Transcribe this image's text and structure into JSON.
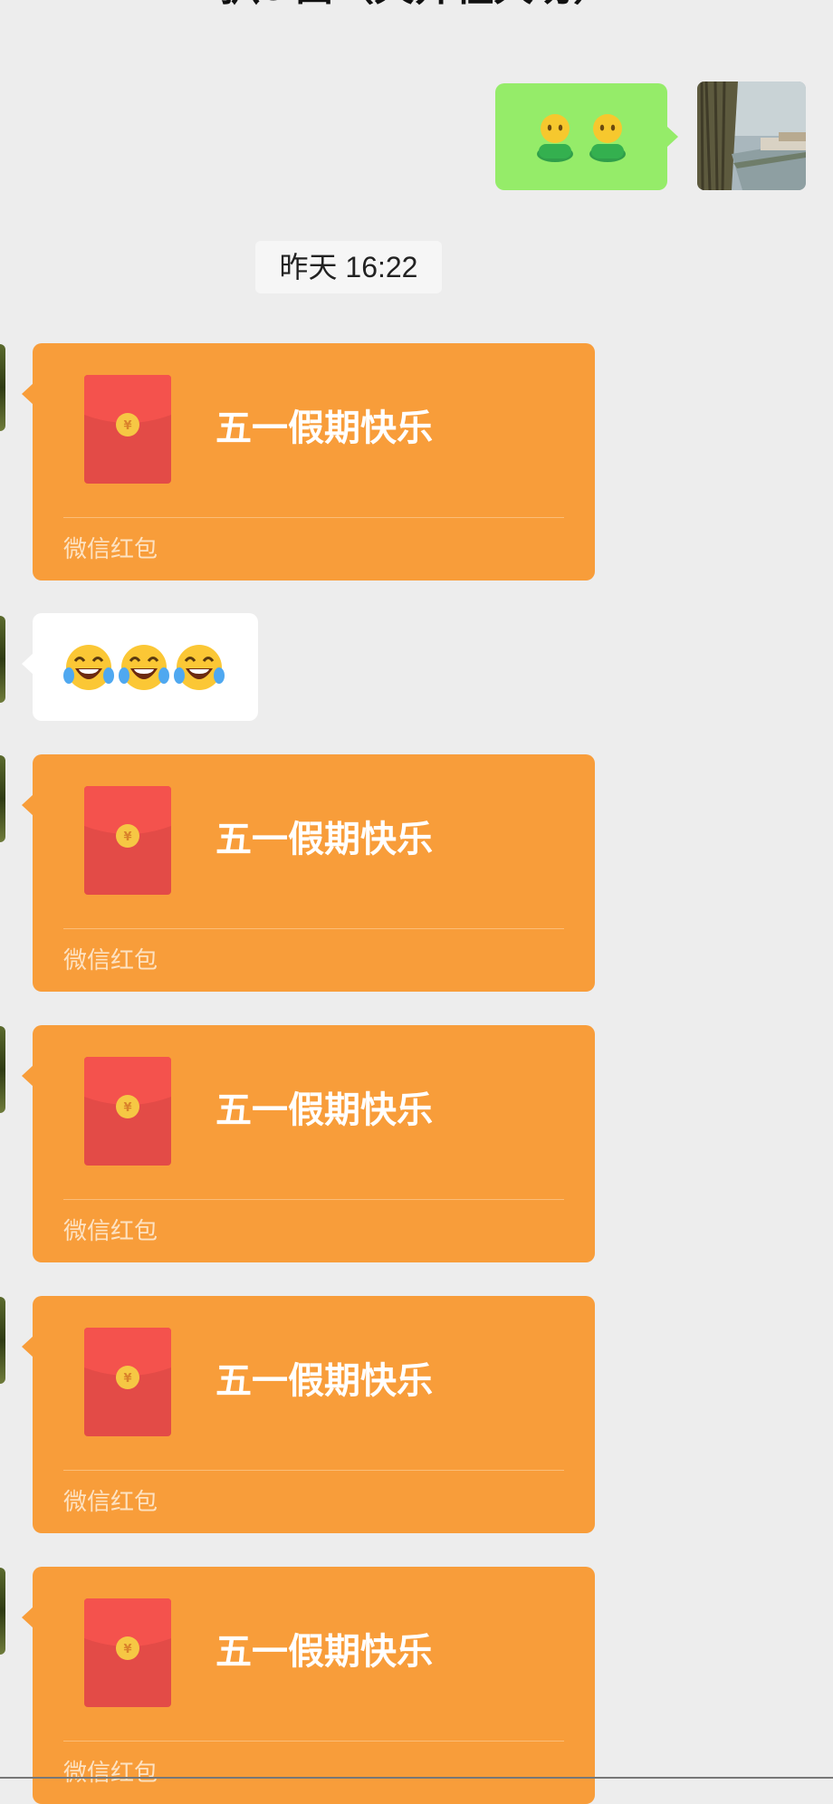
{
  "header": {
    "title": "扒&酉（天井粗大坊）"
  },
  "messages": {
    "outgoing_emoji": {
      "icon": "two-people-emoji-icon"
    },
    "timestamp": "昨天 16:22",
    "red_packet_1": {
      "title": "五一假期快乐",
      "label": "微信红包"
    },
    "laugh_text": {
      "icon": "laugh-cry-emoji-icon",
      "count": 3
    },
    "red_packet_2": {
      "title": "五一假期快乐",
      "label": "微信红包"
    },
    "red_packet_3": {
      "title": "五一假期快乐",
      "label": "微信红包"
    },
    "red_packet_4": {
      "title": "五一假期快乐",
      "label": "微信红包"
    },
    "red_packet_5": {
      "title": "五一假期快乐",
      "label": "微信红包"
    }
  },
  "colors": {
    "background": "#ededed",
    "outgoing_bubble": "#95ec69",
    "red_packet": "#f89d3a",
    "envelope": "#e34b47"
  }
}
